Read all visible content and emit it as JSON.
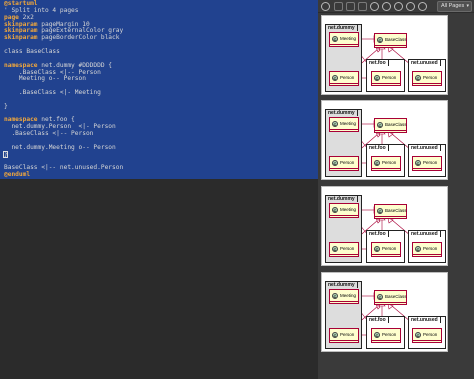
{
  "editor": {
    "lines": [
      {
        "kw": "@startuml",
        "text": ""
      },
      {
        "kw": "",
        "text": "' Split into 4 pages"
      },
      {
        "kw": "page",
        "text": " 2x2"
      },
      {
        "kw": "skinparam",
        "text": " pageMargin 10"
      },
      {
        "kw": "skinparam",
        "text": " pageExternalColor gray"
      },
      {
        "kw": "skinparam",
        "text": " pageBorderColor black"
      },
      {
        "kw": "",
        "text": ""
      },
      {
        "kw": "",
        "text": "class BaseClass"
      },
      {
        "kw": "",
        "text": ""
      },
      {
        "kw": "namespace",
        "text": " net.dummy #DDDDDD {"
      },
      {
        "kw": "",
        "text": "    .BaseClass <|-- Person"
      },
      {
        "kw": "",
        "text": "    Meeting o-- Person"
      },
      {
        "kw": "",
        "text": ""
      },
      {
        "kw": "",
        "text": "    .BaseClass <|- Meeting"
      },
      {
        "kw": "",
        "text": ""
      },
      {
        "kw": "",
        "text": "}"
      },
      {
        "kw": "",
        "text": ""
      },
      {
        "kw": "namespace",
        "text": " net.foo {"
      },
      {
        "kw": "",
        "text": "  net.dummy.Person  <|- Person"
      },
      {
        "kw": "",
        "text": "  .BaseClass <|-- Person"
      },
      {
        "kw": "",
        "text": ""
      },
      {
        "kw": "",
        "text": "  net.dummy.Meeting o-- Person"
      },
      {
        "kw": "",
        "text": "}"
      },
      {
        "kw": "",
        "text": ""
      },
      {
        "kw": "",
        "text": "BaseClass <|-- net.unused.Person"
      },
      {
        "kw": "@enduml",
        "text": ""
      }
    ]
  },
  "toolbar": {
    "icons": [
      "refresh-icon",
      "copy-icon",
      "save-icon",
      "export-icon",
      "zoom-fit-icon",
      "zoom-in-icon",
      "zoom-out-icon",
      "zoom-reset-icon",
      "settings-icon"
    ],
    "pages_select": "All Pages"
  },
  "diagram": {
    "packages": {
      "dummy": "net.dummy",
      "foo": "net.foo",
      "unused": "net.unused"
    },
    "classes": {
      "meeting": "Meeting",
      "baseclass": "BaseClass",
      "person": "Person"
    },
    "circle_letter": "C",
    "colors": {
      "class_bg": "#fefece",
      "class_border": "#a80036",
      "circle": "#add1b2",
      "pkg_gray": "#dddddd",
      "arrow": "#a80036"
    }
  },
  "pages": [
    1,
    2,
    3,
    4
  ]
}
